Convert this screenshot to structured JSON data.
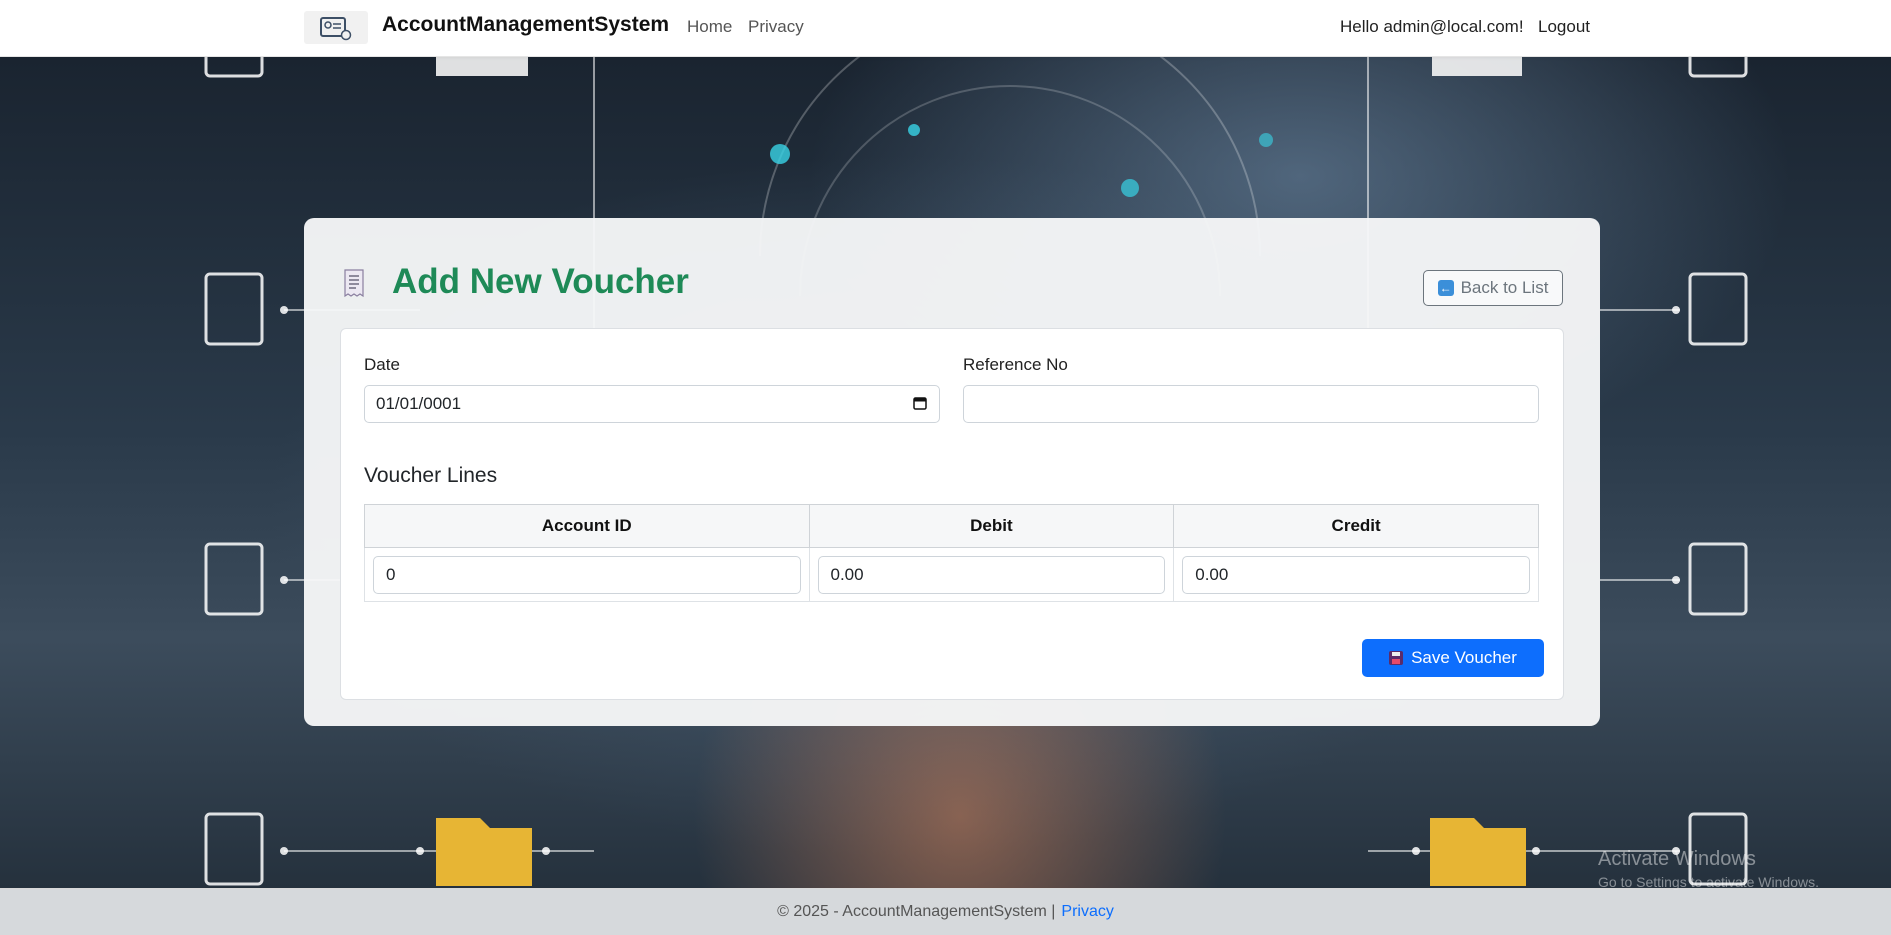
{
  "navbar": {
    "brand": "AccountManagementSystem",
    "home": "Home",
    "privacy": "Privacy",
    "greeting": "Hello admin@local.com!",
    "logout": "Logout"
  },
  "page": {
    "title": "Add New Voucher",
    "back_label": "Back to List"
  },
  "form": {
    "date_label": "Date",
    "date_value": "01/01/0001",
    "reference_label": "Reference No",
    "reference_value": "",
    "lines_title": "Voucher Lines",
    "columns": [
      "Account ID",
      "Debit",
      "Credit"
    ],
    "rows": [
      {
        "account_id": "0",
        "debit": "0.00",
        "credit": "0.00"
      }
    ],
    "save_label": "Save Voucher"
  },
  "footer": {
    "text": "© 2025 - AccountManagementSystem |",
    "privacy_link": "Privacy"
  },
  "os_watermark": {
    "line1": "Activate Windows",
    "line2": "Go to Settings to activate Windows."
  },
  "colors": {
    "title": "#1e8a57",
    "primary": "#0d6efd",
    "secondary": "#6c757d"
  },
  "icons": [
    "app-logo-icon",
    "receipt-icon",
    "back-arrow-icon",
    "calendar-icon",
    "floppy-disk-icon"
  ]
}
